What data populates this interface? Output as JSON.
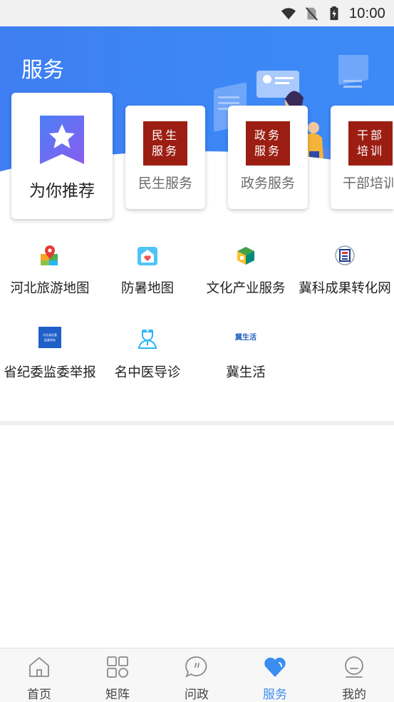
{
  "status_bar": {
    "time": "10:00"
  },
  "header": {
    "title": "服务"
  },
  "cards": [
    {
      "label": "为你推荐",
      "icon": "star-ribbon-icon"
    },
    {
      "label": "民生服务",
      "seal_line1": "民生",
      "seal_line2": "服务"
    },
    {
      "label": "政务服务",
      "seal_line1": "政务",
      "seal_line2": "服务"
    },
    {
      "label": "干部培训",
      "seal_line1": "干部",
      "seal_line2": "培训"
    }
  ],
  "grid": [
    {
      "label": "河北旅游地图",
      "icon": "map-pin-icon"
    },
    {
      "label": "防暑地图",
      "icon": "house-heart-icon"
    },
    {
      "label": "文化产业服务",
      "icon": "cube-icon"
    },
    {
      "label": "冀科成果转化网",
      "icon": "ji-logo-icon"
    },
    {
      "label": "省纪委监委举报",
      "icon": "report-banner-icon",
      "icon_text_line1": "河北省纪委",
      "icon_text_line2": "监委网站"
    },
    {
      "label": "名中医导诊",
      "icon": "doctor-icon"
    },
    {
      "label": "冀生活",
      "icon": "ji-life-logo-icon",
      "icon_text": "冀生活"
    }
  ],
  "bottom_nav": [
    {
      "label": "首页",
      "icon": "home-icon"
    },
    {
      "label": "矩阵",
      "icon": "grid-icon"
    },
    {
      "label": "问政",
      "icon": "chat-bubble-icon"
    },
    {
      "label": "服务",
      "icon": "heart-icon",
      "active": true
    },
    {
      "label": "我的",
      "icon": "profile-icon"
    }
  ],
  "colors": {
    "header_blue": "#3d84f4",
    "active_blue": "#3a8ef0",
    "seal_red": "#9c1e13"
  }
}
